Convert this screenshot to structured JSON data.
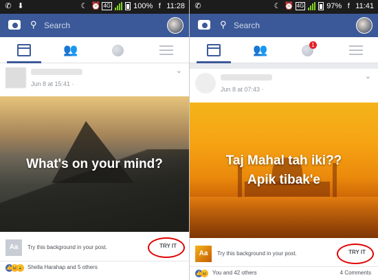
{
  "left": {
    "status": {
      "net_badge": "4G",
      "battery": "100%",
      "time": "11:28"
    },
    "search": {
      "placeholder": "Search"
    },
    "post": {
      "time": "Jun 8 at 15:41 · ",
      "caption": "What's on your mind?"
    },
    "try": {
      "thumb": "Aa",
      "text": "Try this background in your post.",
      "button": "TRY IT"
    },
    "reactions": {
      "text": "Shella Harahap and 5 others"
    }
  },
  "right": {
    "status": {
      "net_badge": "4G",
      "battery": "97%",
      "time": "11:41"
    },
    "search": {
      "placeholder": "Search"
    },
    "notifications": {
      "count": "1"
    },
    "post": {
      "time": "Jun 8 at 07:43 · ",
      "caption_line1": "Taj Mahal tah iki??",
      "caption_line2": "Apik tibak'e"
    },
    "try": {
      "thumb": "Aa",
      "text": "Try this background in your post.",
      "button": "TRY IT"
    },
    "reactions": {
      "text": "You and 42 others",
      "comments": "4 Comments"
    }
  },
  "colors": {
    "brand": "#3b5998",
    "highlight_ring": "#e00000"
  },
  "icons": [
    "camera-icon",
    "search-icon",
    "news-feed-icon",
    "friends-icon",
    "globe-icon",
    "menu-icon",
    "chevron-down-icon",
    "like-reaction-icon",
    "haha-reaction-icon"
  ]
}
